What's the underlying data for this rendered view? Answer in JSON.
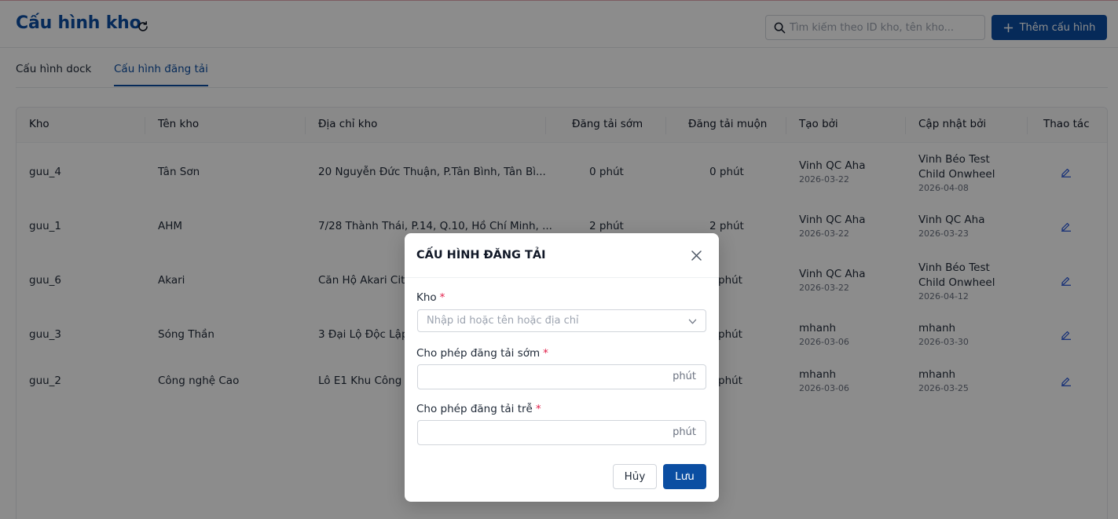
{
  "header": {
    "title": "Cấu hình kho",
    "search_placeholder": "Tìm kiếm theo ID kho, tên kho...",
    "add_label": "Thêm cấu hình"
  },
  "tabs": [
    {
      "label": "Cấu hình dock",
      "active": false
    },
    {
      "label": "Cấu hình đăng tải",
      "active": true
    }
  ],
  "table": {
    "columns": [
      "Kho",
      "Tên kho",
      "Địa chỉ kho",
      "Đăng tải sớm",
      "Đăng tải muộn",
      "Tạo bởi",
      "Cập nhật bởi",
      "Thao tác"
    ],
    "rows": [
      {
        "kho": "guu_4",
        "ten_kho": "Tân Sơn",
        "dia_chi": "20 Nguyễn Đức Thuận, P.Tân Bình, Tân Bì...",
        "som": "0 phút",
        "muon": "0 phút",
        "tao_boi": "Vinh QC Aha",
        "tao_ngay": "2026-03-22",
        "cap_nhat_boi_1": "Vinh Béo Test",
        "cap_nhat_boi_2": "Child Onwheel",
        "cap_nhat_ngay": "2026-04-08"
      },
      {
        "kho": "guu_1",
        "ten_kho": "AHM",
        "dia_chi": "7/28 Thành Thái, P.14, Q.10, Hồ Chí Minh, ...",
        "som": "2 phút",
        "muon": "2 phút",
        "tao_boi": "Vinh QC Aha",
        "tao_ngay": "2026-03-22",
        "cap_nhat_boi_1": "Vinh QC Aha",
        "cap_nhat_boi_2": "",
        "cap_nhat_ngay": "2026-03-23"
      },
      {
        "kho": "guu_6",
        "ten_kho": "Akari",
        "dia_chi": "Căn Hộ Akari City",
        "som": "",
        "muon": "phút",
        "tao_boi": "Vinh QC Aha",
        "tao_ngay": "2026-03-22",
        "cap_nhat_boi_1": "Vinh Béo Test",
        "cap_nhat_boi_2": "Child Onwheel",
        "cap_nhat_ngay": "2026-04-12"
      },
      {
        "kho": "guu_3",
        "ten_kho": "Sóng Thần",
        "dia_chi": "3 Đại Lộ Độc Lập",
        "som": "",
        "muon": "phút",
        "tao_boi": "mhanh",
        "tao_ngay": "2026-03-06",
        "cap_nhat_boi_1": "mhanh",
        "cap_nhat_boi_2": "",
        "cap_nhat_ngay": "2026-03-30"
      },
      {
        "kho": "guu_2",
        "ten_kho": "Công nghệ Cao",
        "dia_chi": "Lô E1 Khu Công N",
        "som": "",
        "muon": "phút",
        "tao_boi": "mhanh",
        "tao_ngay": "2026-03-06",
        "cap_nhat_boi_1": "mhanh",
        "cap_nhat_boi_2": "",
        "cap_nhat_ngay": "2026-03-25"
      }
    ]
  },
  "modal": {
    "title": "CẤU HÌNH ĐĂNG TẢI",
    "kho_label": "Kho",
    "kho_placeholder": "Nhập id hoặc tên hoặc địa chỉ",
    "som_label": "Cho phép đăng tải sớm",
    "tre_label": "Cho phép đăng tải trễ",
    "unit": "phút",
    "required_mark": "*",
    "cancel_label": "Hủy",
    "save_label": "Lưu"
  },
  "colors": {
    "primary": "#0b4ea2",
    "required": "#e11d48",
    "overlay": "rgba(0,0,0,0.45)"
  },
  "icons": [
    "refresh-icon",
    "search-icon",
    "plus-icon",
    "edit-icon",
    "close-icon",
    "chevron-down-icon"
  ]
}
